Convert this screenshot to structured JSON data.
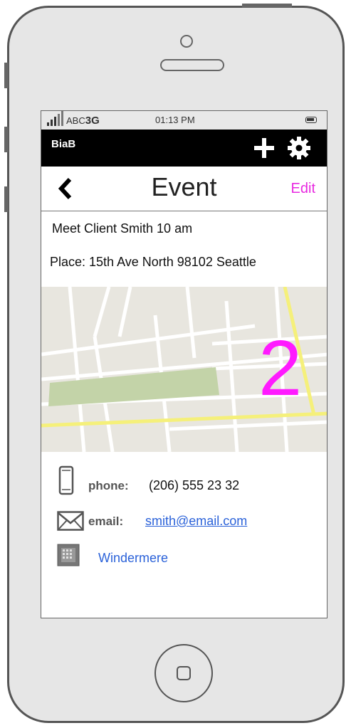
{
  "status_bar": {
    "carrier": "ABC",
    "network": "3G",
    "time": "01:13 PM"
  },
  "app_bar": {
    "title": "BiaB",
    "add_icon": "plus-icon",
    "settings_icon": "gear-icon"
  },
  "nav_bar": {
    "back_icon": "chevron-left-icon",
    "title": "Event",
    "edit_label": "Edit"
  },
  "event": {
    "title": "Meet Client Smith 10 am",
    "place": "Place: 15th Ave North 98102 Seattle",
    "map_badge": "2"
  },
  "contacts": {
    "phone_label": "phone:",
    "phone_value": "(206) 555 23 32",
    "email_label": "email:",
    "email_value": "smith@email.com",
    "company_value": "Windermere"
  },
  "colors": {
    "accent": "#e829e0",
    "link": "#2b62d9",
    "map_road_highlight": "#f5f07a",
    "map_park": "#c3d3a8"
  }
}
